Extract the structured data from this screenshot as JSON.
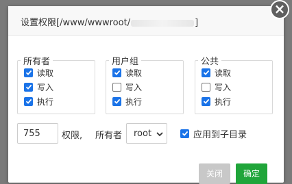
{
  "dialog": {
    "title_prefix": "设置权限[/www/wwwroot/",
    "title_suffix": "]",
    "close_glyph": "×"
  },
  "groups": [
    {
      "legend": "所有者",
      "items": [
        {
          "label": "读取",
          "checked": true
        },
        {
          "label": "写入",
          "checked": true
        },
        {
          "label": "执行",
          "checked": true
        }
      ]
    },
    {
      "legend": "用户组",
      "items": [
        {
          "label": "读取",
          "checked": true
        },
        {
          "label": "写入",
          "checked": false
        },
        {
          "label": "执行",
          "checked": true
        }
      ]
    },
    {
      "legend": "公共",
      "items": [
        {
          "label": "读取",
          "checked": true
        },
        {
          "label": "写入",
          "checked": false
        },
        {
          "label": "执行",
          "checked": true
        }
      ]
    }
  ],
  "permission": {
    "value": "755",
    "label": "权限,",
    "owner_label": "所有者",
    "owner_selected": "root",
    "apply_sub_label": "应用到子目录",
    "apply_sub_checked": true
  },
  "footer": {
    "close_label": "关闭",
    "confirm_label": "确定"
  },
  "colors": {
    "accent": "#1a73e8",
    "confirm": "#20a53a",
    "close_disabled": "#c8c8c8"
  }
}
